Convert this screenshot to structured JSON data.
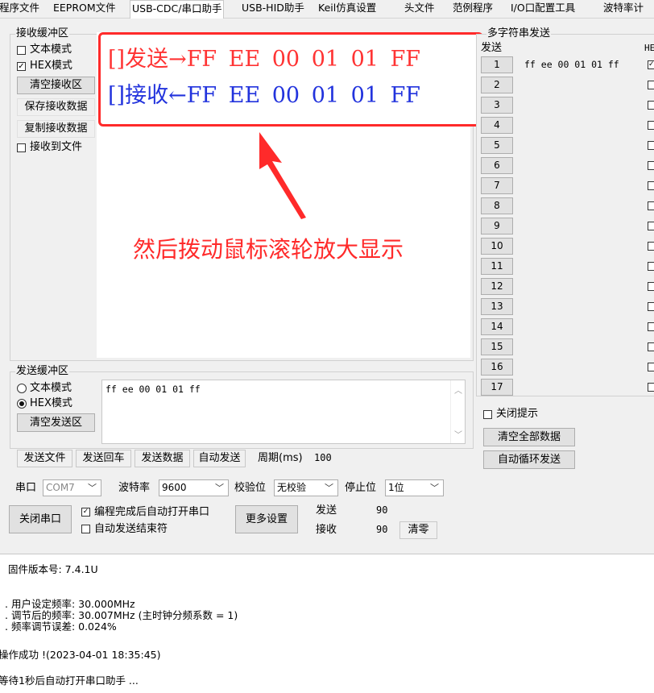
{
  "tabs": [
    "程序文件",
    "EEPROM文件",
    "USB-CDC/串口助手",
    "USB-HID助手",
    "Keil仿真设置",
    "头文件",
    "范例程序",
    "I/O口配置工具",
    "波特率计"
  ],
  "recv": {
    "group_title": "接收缓冲区",
    "text_mode": "文本模式",
    "hex_mode": "HEX模式",
    "clear_btn": "清空接收区",
    "save_btn": "保存接收数据",
    "copy_btn": "复制接收数据",
    "to_file": "接收到文件"
  },
  "overlay": {
    "send_line": {
      "prefix": "[]发送",
      "arrow": "→",
      "data": "FF EE 00 01 01 FF"
    },
    "recv_line": {
      "prefix": "[]接收",
      "arrow": "←",
      "data": "FF EE 00 01 01 FF"
    },
    "hint": "然后拨动鼠标滚轮放大显示",
    "colors": {
      "send": "#ff3333",
      "recv": "#2233dd",
      "frame": "#ff2a2a"
    }
  },
  "multi": {
    "title": "多字符串发送",
    "send_header": "发送",
    "hex_header": "HE",
    "rows": [
      "1",
      "2",
      "3",
      "4",
      "5",
      "6",
      "7",
      "8",
      "9",
      "10",
      "11",
      "12",
      "13",
      "14",
      "15",
      "16",
      "17"
    ],
    "row1_value": "ff ee 00 01 01 ff",
    "close_tip": "关闭提示",
    "clear_all": "清空全部数据",
    "auto_loop": "自动循环发送"
  },
  "send": {
    "group_title": "发送缓冲区",
    "text_mode": "文本模式",
    "hex_mode": "HEX模式",
    "clear_btn": "清空发送区",
    "content": "ff ee 00 01 01 ff",
    "send_file": "发送文件",
    "send_enter": "发送回车",
    "send_data": "发送数据",
    "auto_send": "自动发送",
    "period_label": "周期(ms)",
    "period_value": "100"
  },
  "port": {
    "port_label": "串口",
    "port_value": "COM7",
    "baud_label": "波特率",
    "baud_value": "9600",
    "parity_label": "校验位",
    "parity_value": "无校验",
    "stop_label": "停止位",
    "stop_value": "1位",
    "close_btn": "关闭串口",
    "auto_open": "编程完成后自动打开串口",
    "auto_end": "自动发送结束符",
    "more_btn": "更多设置",
    "sent_label": "发送",
    "sent_value": "90",
    "recv_label": "接收",
    "recv_value": "90",
    "reset_btn": "清零"
  },
  "log": {
    "firmware": "固件版本号: 7.4.1U",
    "line1": ". 用户设定频率: 30.000MHz",
    "line2": ". 调节后的频率: 30.007MHz (主时钟分频系数 = 1)",
    "line3": ". 频率调节误差: 0.024%",
    "success": "操作成功 !(2023-04-01 18:35:45)",
    "waiting": "等待1秒后自动打开串口助手 ..."
  }
}
